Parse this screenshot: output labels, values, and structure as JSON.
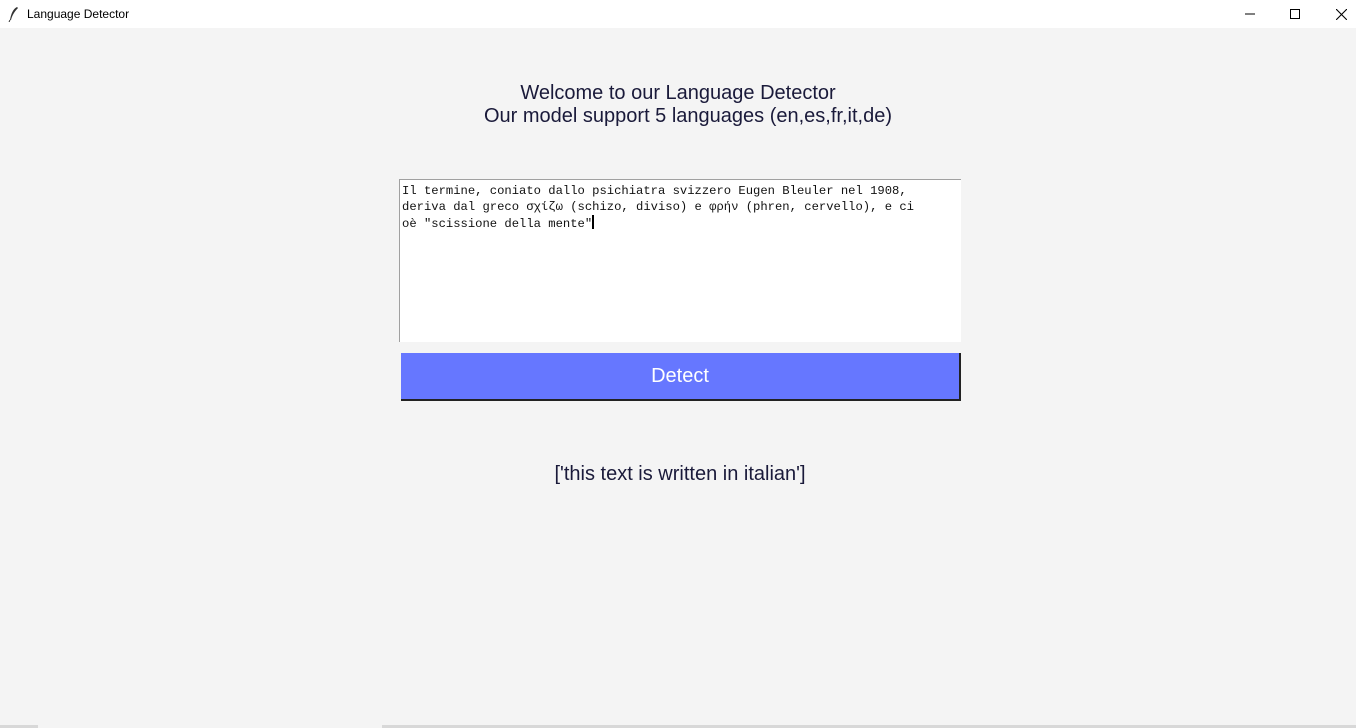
{
  "window": {
    "title": "Language Detector"
  },
  "header": {
    "line1": "Welcome to our Language Detector",
    "line2": "Our model support 5 languages (en,es,fr,it,de)"
  },
  "input": {
    "line1": "Il termine, coniato dallo psichiatra svizzero Eugen Bleuler nel 1908,",
    "line2": "deriva dal greco σχίζω (schizo, diviso) e φρήν (phren, cervello), e ci",
    "line3": "oè \"scissione della mente\""
  },
  "detect_button": {
    "label": "Detect",
    "color": "#6677ff"
  },
  "result": {
    "text": "['this text is written in italian']"
  }
}
